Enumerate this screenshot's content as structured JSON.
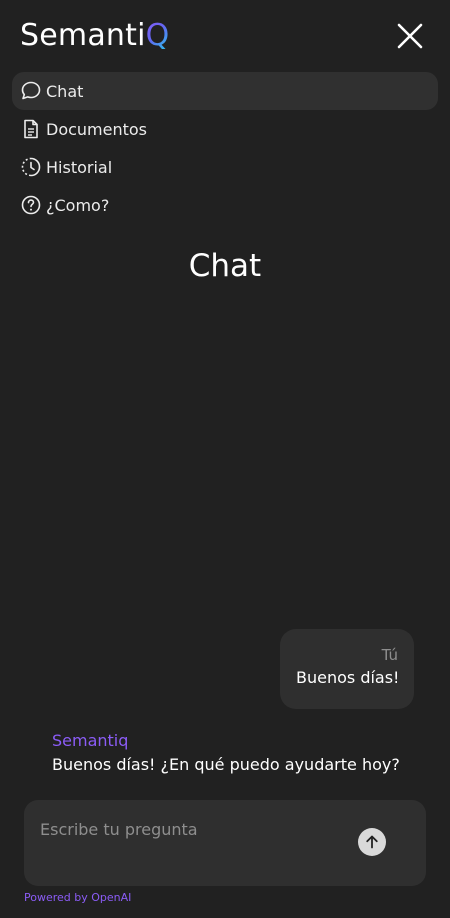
{
  "header": {
    "logo_prefix": "Semanti",
    "logo_suffix": "Q",
    "close_icon": "close-icon"
  },
  "nav": {
    "items": [
      {
        "label": "Chat",
        "icon": "chat-bubble-icon",
        "active": true
      },
      {
        "label": "Documentos",
        "icon": "document-icon",
        "active": false
      },
      {
        "label": "Historial",
        "icon": "history-clock-icon",
        "active": false
      },
      {
        "label": "¿Como?",
        "icon": "help-circle-icon",
        "active": false
      }
    ]
  },
  "main": {
    "title": "Chat"
  },
  "messages": {
    "user": {
      "sender": "Tú",
      "text": "Buenos días!"
    },
    "assistant": {
      "sender": "Semantiq",
      "text": "Buenos días! ¿En qué puedo ayudarte hoy?"
    }
  },
  "composer": {
    "placeholder": "Escribe tu pregunta",
    "value": "",
    "send_icon": "arrow-up-icon"
  },
  "footer": {
    "powered_by": "Powered by OpenAI"
  },
  "colors": {
    "background": "#212121",
    "surface": "#2f2f2f",
    "accent": "#8b5cf6",
    "text": "#ececec"
  }
}
